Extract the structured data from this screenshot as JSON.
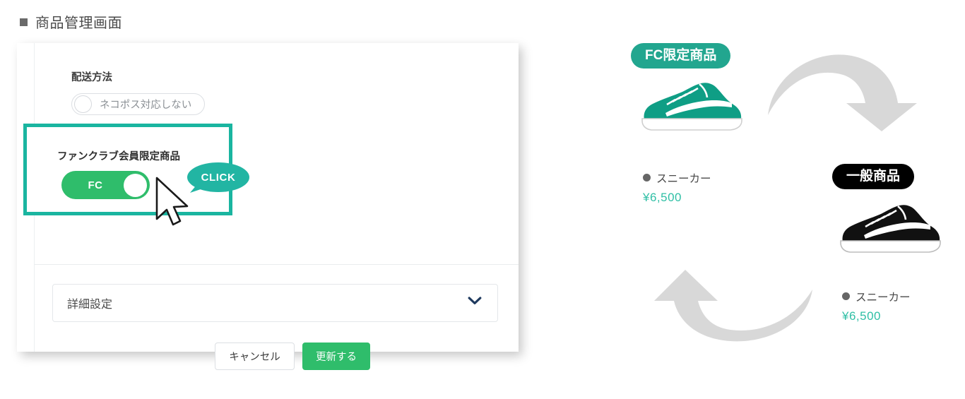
{
  "page": {
    "title": "商品管理画面",
    "title_bullet": "■"
  },
  "form": {
    "shipping": {
      "label": "配送方法",
      "toggle_label": "ネコポス対応しない",
      "toggle_state": "off"
    },
    "fanclub": {
      "label": "ファンクラブ会員限定商品",
      "toggle_label": "FC",
      "toggle_state": "on",
      "highlight_color": "#1ab5a0",
      "toggle_color": "#2fbd6b",
      "callout": "CLICK",
      "callout_color": "#22b5a3",
      "cursor_icon": "mouse-cursor-icon"
    },
    "accordion": {
      "label": "詳細設定",
      "chevron_icon": "chevron-down-icon"
    },
    "buttons": {
      "cancel": "キャンセル",
      "update": "更新する",
      "update_color": "#2fbd6b"
    }
  },
  "illustration": {
    "fc_badge": {
      "label": "FC限定商品",
      "color": "#22a68f"
    },
    "general_badge": {
      "label": "一般商品",
      "color": "#000000"
    },
    "fc_product": {
      "icon": "sneaker-icon",
      "color": "#0f9e85",
      "bullet": "●",
      "name": "スニーカー",
      "price": "¥6,500"
    },
    "general_product": {
      "icon": "sneaker-icon",
      "color": "#111111",
      "bullet": "●",
      "name": "スニーカー",
      "price": "¥6,500"
    },
    "arrow_top": "curved-arrow-down-icon",
    "arrow_bottom": "curved-arrow-up-icon",
    "arrow_color": "#d6d6d6"
  }
}
